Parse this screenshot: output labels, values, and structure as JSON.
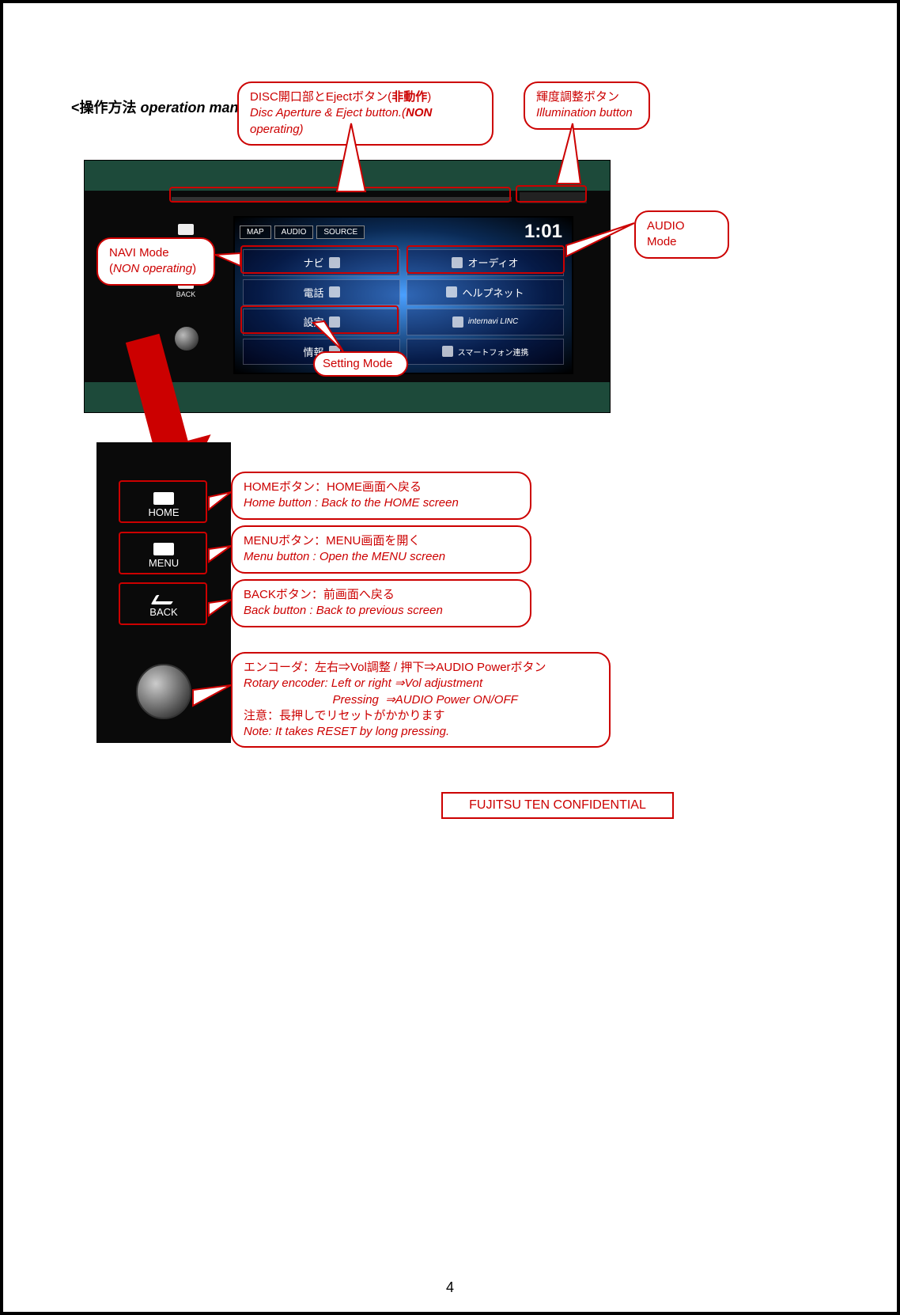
{
  "section_title": {
    "jp": "<操作方法 ",
    "en": "operation manual",
    "close": ">"
  },
  "callouts": {
    "disc": {
      "jp_pre": "DISC開口部とEjectボタン(",
      "jp_bold": "非動作",
      "jp_post": ")",
      "en_pre": "Disc Aperture & Eject button.(",
      "en_bold": "NON",
      "en_post": " operating)"
    },
    "illum": {
      "jp": "輝度調整ボタン",
      "en": "Illumination button"
    },
    "navi": {
      "line1": "NAVI Mode",
      "line2_pre": "(",
      "line2_em": "NON operating",
      "line2_post": ")"
    },
    "audio": {
      "text": "AUDIO Mode"
    },
    "setting": {
      "text": "Setting Mode"
    },
    "home": {
      "jp": "HOMEボタン：HOME画面へ戻る",
      "en": "Home button : Back to the HOME screen"
    },
    "menu": {
      "jp": "MENUボタン：MENU画面を開く",
      "en": "Menu button : Open the MENU screen"
    },
    "back": {
      "jp": "BACKボタン：前画面へ戻る",
      "en": "Back button : Back to previous screen"
    },
    "encoder": {
      "jp1": "エンコーダ：左右⇒Vol調整  /  押下⇒AUDIO Powerボタン",
      "en1": "Rotary encoder: Left or right  ⇒Vol adjustment",
      "en2": "                           Pressing  ⇒AUDIO Power ON/OFF",
      "jp2": "注意：長押しでリセットがかかります",
      "en3": "Note: It takes RESET by long pressing."
    }
  },
  "screen": {
    "tabs": [
      "MAP",
      "AUDIO",
      "SOURCE"
    ],
    "clock": "1:01",
    "apps": [
      "ナビ",
      "オーディオ",
      "電話",
      "ヘルプネット",
      "設定",
      "internavi LINC",
      "情報",
      "スマートフォン連携"
    ]
  },
  "side_labels": [
    "HOME",
    "MENU",
    "BACK"
  ],
  "phys_buttons": [
    "HOME",
    "MENU",
    "BACK"
  ],
  "confidential": "FUJITSU TEN CONFIDENTIAL",
  "page_number": "4"
}
